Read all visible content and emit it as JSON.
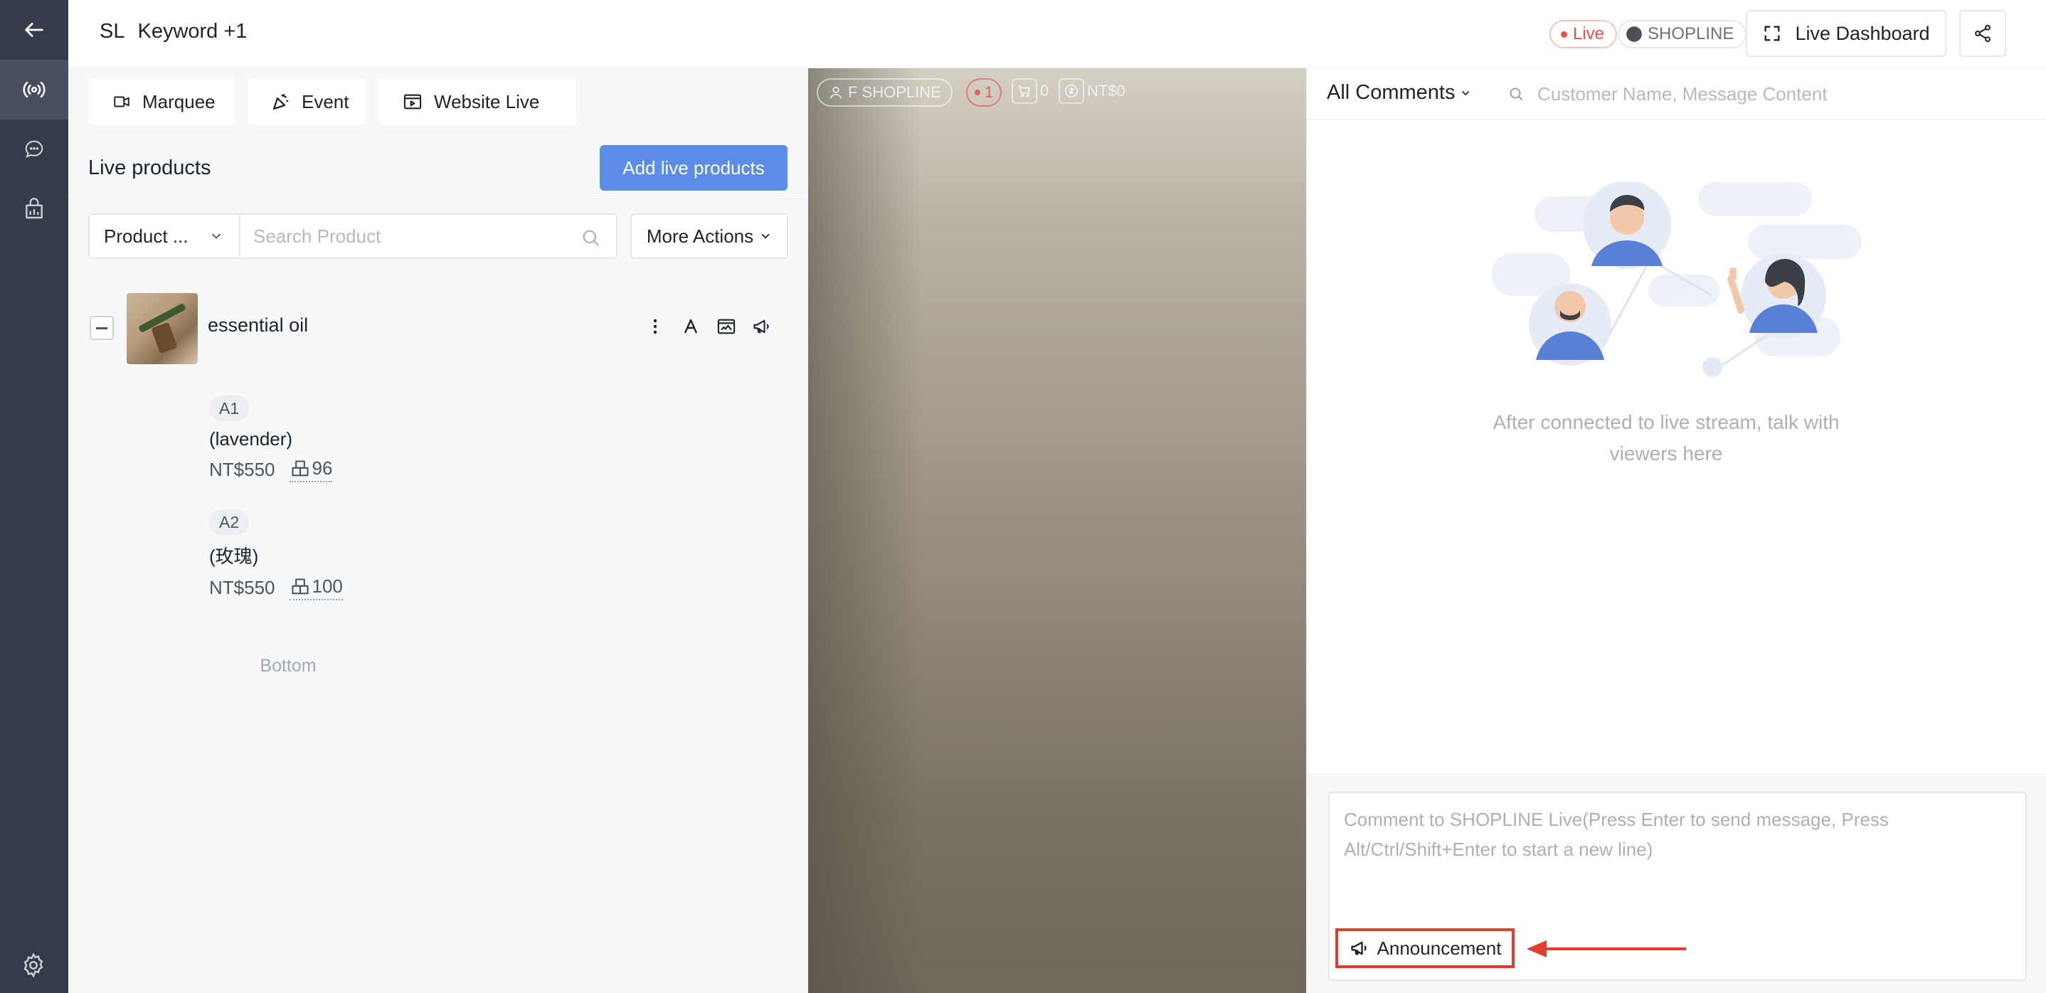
{
  "header": {
    "brand_short": "SL",
    "title": "Keyword +1",
    "live_badge": "Live",
    "channel_badge": "SHOPLINE",
    "dashboard_label": "Live Dashboard"
  },
  "toolbar": {
    "marquee": "Marquee",
    "event": "Event",
    "website_live": "Website Live"
  },
  "live_products": {
    "title": "Live products",
    "add_button": "Add live products",
    "filter_label": "Product ...",
    "search_placeholder": "Search Product",
    "more_actions": "More Actions",
    "product": {
      "name": "essential oil",
      "variants": [
        {
          "tag": "A1",
          "name": "(lavender)",
          "price": "NT$550",
          "stock": "96"
        },
        {
          "tag": "A2",
          "name": "(玫瑰)",
          "price": "NT$550",
          "stock": "100"
        }
      ]
    },
    "bottom_note": "Bottom"
  },
  "video_overlay": {
    "account": "F SHOPLINE",
    "viewers": "1",
    "cart": "0",
    "revenue": "NT$0"
  },
  "comments": {
    "filter": "All Comments",
    "search_placeholder": "Customer Name, Message Content",
    "empty_text": "After connected to live stream, talk with viewers here",
    "composer_placeholder": "Comment to SHOPLINE Live(Press Enter to send message, Press Alt/Ctrl/Shift+Enter to start a new line)",
    "announcement": "Announcement"
  },
  "colors": {
    "rail": "#353b48",
    "accent": "#5b8ce8",
    "live": "#e8514a",
    "highlight": "#e23d2e"
  }
}
